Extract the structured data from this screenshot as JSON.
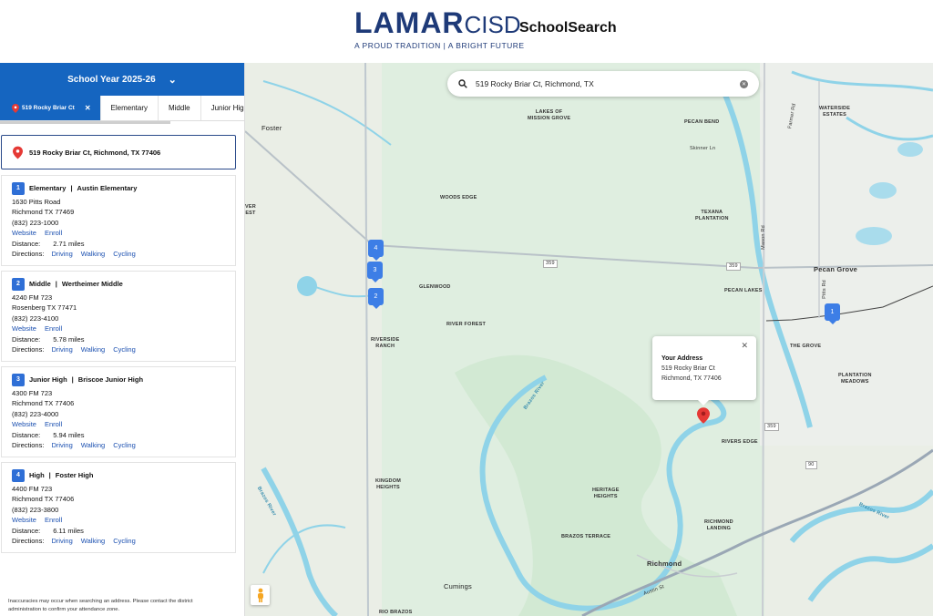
{
  "header": {
    "logo_main": "LAMAR",
    "logo_suffix": "CISD",
    "logo_tagline": "A PROUD TRADITION | A BRIGHT FUTURE",
    "app_name": "SchoolSearch"
  },
  "sidebar": {
    "school_year": "School Year 2025-26",
    "tabs": [
      {
        "label": "519 Rocky Briar Ct",
        "active": true
      },
      {
        "label": "Elementary"
      },
      {
        "label": "Middle"
      },
      {
        "label": "Junior High"
      }
    ],
    "address": "519 Rocky Briar Ct, Richmond, TX 77406",
    "labels": {
      "distance": "Distance:",
      "directions": "Directions:",
      "website": "Website",
      "enroll": "Enroll",
      "driving": "Driving",
      "walking": "Walking",
      "cycling": "Cycling",
      "sep": "|"
    },
    "schools": [
      {
        "num": "1",
        "level": "Elementary",
        "name": "Austin Elementary",
        "street": "1630 Pitts Road",
        "city": "Richmond TX 77469",
        "phone": "(832) 223-1000",
        "distance": "2.71 miles"
      },
      {
        "num": "2",
        "level": "Middle",
        "name": "Wertheimer Middle",
        "street": "4240 FM 723",
        "city": "Rosenberg TX 77471",
        "phone": "(832) 223-4100",
        "distance": "5.78 miles"
      },
      {
        "num": "3",
        "level": "Junior High",
        "name": "Briscoe Junior High",
        "street": "4300 FM 723",
        "city": "Richmond TX 77406",
        "phone": "(832) 223-4000",
        "distance": "5.94 miles"
      },
      {
        "num": "4",
        "level": "High",
        "name": "Foster High",
        "street": "4400 FM 723",
        "city": "Richmond TX 77406",
        "phone": "(832) 223-3800",
        "distance": "6.11 miles"
      }
    ],
    "disclaimer": "Inaccuracies may occur when searching an address. Please contact the district administration to confirm your attendance zone."
  },
  "map": {
    "search_value": "519 Rocky Briar Ct, Richmond, TX",
    "popup": {
      "title": "Your Address",
      "line1": "519 Rocky Briar Ct",
      "line2": "Richmond, TX 77406"
    },
    "markers": [
      "1",
      "2",
      "3",
      "4"
    ],
    "labels": {
      "foster": "Foster",
      "lakes_mission": "LAKES OF\nMISSION GROVE",
      "pecan_bend": "PECAN BEND",
      "skinner": "Skinner Ln",
      "waterside": "WATERSIDE\nESTATES",
      "woods_edge": "WOODS EDGE",
      "texana": "TEXANA\nPLANTATION",
      "pecan_grove": "Pecan Grove",
      "pecan_lakes": "PECAN LAKES",
      "glenwood": "GLENWOOD",
      "river_forest": "RIVER FOREST",
      "riverside": "RIVERSIDE\nRANCH",
      "the_grove": "THE GROVE",
      "plantation_meadows": "PLANTATION\nMEADOWS",
      "rivers_edge": "RIVERS EDGE",
      "kingdom": "KINGDOM\nHEIGHTS",
      "heritage": "HERITAGE\nHEIGHTS",
      "richmond_landing": "RICHMOND\nLANDING",
      "brazos_terrace": "BRAZOS TERRACE",
      "richmond": "Richmond",
      "cumings": "Cumings",
      "rio_brazos": "RIO BRAZOS",
      "brazos_river": "Brazos River",
      "brazos_river2": "Brazos River",
      "brazos_river3": "Brazos River",
      "hwy359a": "359",
      "hwy359b": "359",
      "hwy359c": "359",
      "hwy90": "90",
      "austin_st": "Austin St",
      "fm_ln": "Farmer Rd",
      "mason_rd": "Mason Rd",
      "pitts_rd": "Pitts Rd",
      "river_est": "VER\nEST"
    }
  }
}
